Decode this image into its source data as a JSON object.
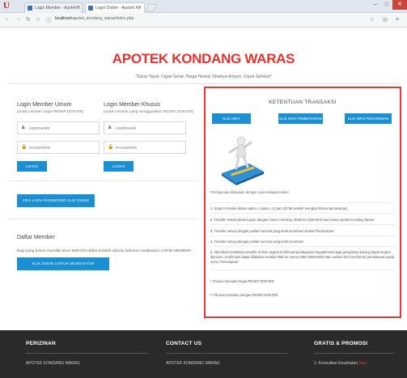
{
  "browser": {
    "tabs": [
      {
        "label": "Login Member - Apotek K"
      },
      {
        "label": "Login Dokter - Apotek Ko"
      }
    ],
    "corner_logo": "U",
    "url_host": "localhost",
    "url_path": "/apotek_kondang_waras/index.php"
  },
  "header": {
    "title": "APOTEK KONDANG WARAS",
    "tagline": "\"Solusi Tepat, Cepat Sehat, Harga Hemat, Obatnya Ampuh, Cepat Sembuh\""
  },
  "login_umum": {
    "title": "Login Member Umum",
    "subtitle": "(untuk member tanpa RESEP DOKTER)",
    "username_placeholder": "USERNAME",
    "password_placeholder": "PASSWORD",
    "button": "LOGIN"
  },
  "login_khusus": {
    "title": "Login Member Khusus",
    "subtitle": "(untuk member yang menggunakan RESEP DOKTER)",
    "username_placeholder": "USERNAME",
    "password_placeholder": "PASSWORD",
    "button": "LOGIN"
  },
  "forgot_button": "JIKA LUPA PASSWORD KLIK DISINI",
  "daftar": {
    "title": "Daftar Member",
    "text": "Bagi yang belum memiliki akun MOHON daftar terlebih dahulu sebelum melakukan LOGIN MEMBER",
    "button": "KLIK DISINI UNTUK MENDAFTAR"
  },
  "panel": {
    "title": "KETENTUAN TRANSAKSI",
    "buttons": [
      "KLIK INFO PEMESANAN",
      "KLIK INFO PEMBAYARAN",
      "KLIK INFO PENGIRIMAN"
    ],
    "lead": "Pembayaran dilakukan dengan cara sebagai berikut",
    "items": [
      "1. Segera transfer dalam waktu 1 (satu) x 24 jam (23:59 setelah mengkonfirmasi pemesanan)",
      "2. Transfer melalui Bank tujuan dengan nomor rekening: 0048-01-0108-50-6 atas nama Apotek Kondang Waras",
      "3. Transfer sesuai dengan jumlah nominal yang telah tercantum di total 'Pemesanan'",
      "4. Transfer sesuai dengan jumlah nominal yang telah tercantum",
      "5. Jika telah melakukan transfer mohon segera konfirmasi pembayaran kepada kami agar pengiriman barang dapat segera diproses. Konfirmasi dapat dilakukan melalui SMS ke nomor 0852-0000-0000 atau melalui form konfirmasi pembayaran pada menu 'Pemesanan'"
    ],
    "notes": [
      "* Khusus transaksi tanpa RESEP DOKTER",
      "** Khusus transaksi dengan RESEP DOKTER"
    ]
  },
  "footer": {
    "columns": [
      {
        "heading": "PERIZINAN",
        "item": "APOTEK KONDANG WARAS"
      },
      {
        "heading": "CONTACT US",
        "item": "APOTEK KONDANG WARAS"
      },
      {
        "heading": "GRATIS & PROMOSI",
        "item": "1. Konsultasi Kesehatan"
      }
    ],
    "badge": "New"
  }
}
